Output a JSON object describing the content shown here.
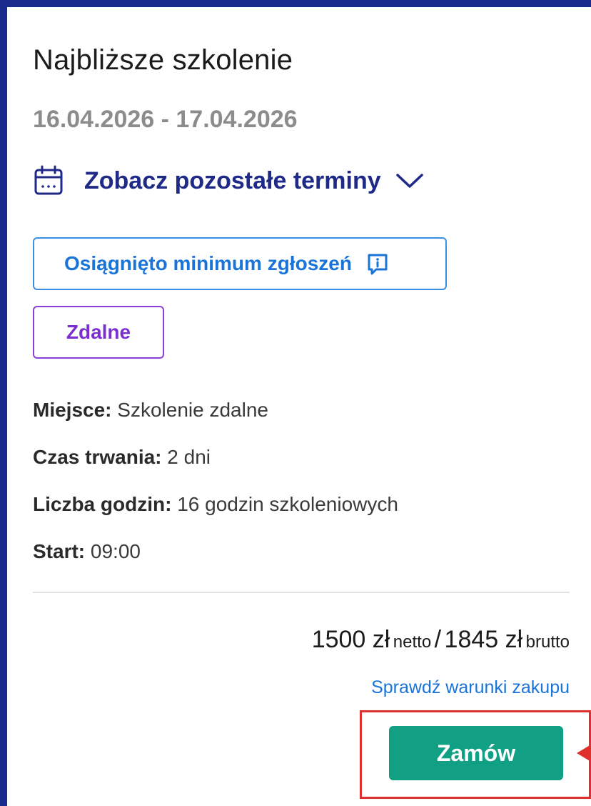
{
  "training": {
    "heading": "Najbliższe szkolenie",
    "dates": "16.04.2026 - 17.04.2026",
    "other_dates_label": "Zobacz pozostałe terminy",
    "status_badge": "Osiągnięto minimum zgłoszeń",
    "mode_badge": "Zdalne",
    "details": [
      {
        "key": "Miejsce:",
        "value": "Szkolenie zdalne"
      },
      {
        "key": "Czas trwania:",
        "value": "2 dni"
      },
      {
        "key": "Liczba godzin:",
        "value": "16 godzin szkoleniowych"
      },
      {
        "key": "Start:",
        "value": "09:00"
      }
    ],
    "price": {
      "net": "1500 zł",
      "net_label": "netto",
      "separator": "/",
      "gross": "1845 zł",
      "gross_label": "brutto"
    },
    "purchase_terms_link": "Sprawdź warunki zakupu",
    "order_button": "Zamów"
  },
  "icons": {
    "calendar": "calendar-icon",
    "chevron": "chevron-down-icon",
    "info": "info-chat-icon",
    "arrow": "arrow-left-icon"
  },
  "colors": {
    "frame": "#182a8c",
    "link_blue": "#1a74d8",
    "navy": "#1f2a88",
    "purple": "#7b2fd0",
    "button_green": "#12a085",
    "highlight_red": "#e0302d"
  }
}
